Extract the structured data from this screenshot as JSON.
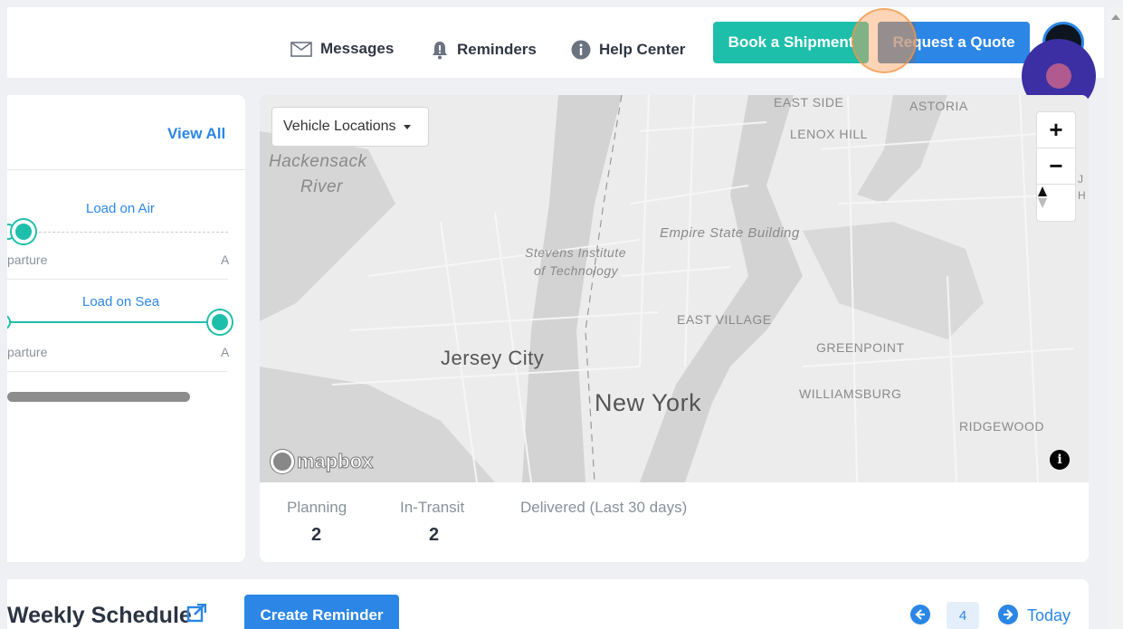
{
  "header": {
    "messages_label": "Messages",
    "reminders_label": "Reminders",
    "help_label": "Help Center",
    "book_label": "Book a Shipment",
    "quote_label": "Request a Quote"
  },
  "shipments_card": {
    "view_all": "View All",
    "rows": [
      {
        "mode": "Load on Air",
        "departure": "parture",
        "arrival": "A"
      },
      {
        "mode": "Load on Sea",
        "departure": "parture",
        "arrival": "A"
      }
    ]
  },
  "map": {
    "dropdown_label": "Vehicle Locations",
    "attribution": "mapbox",
    "labels": {
      "east_side": "EAST SIDE",
      "astoria": "ASTORIA",
      "lenox_hill": "LENOX HILL",
      "hackensack": "Hackensack",
      "river": "River",
      "empire": "Empire State Building",
      "stevens1": "Stevens Institute",
      "stevens2": "of Technology",
      "east_village": "EAST VILLAGE",
      "greenpoint": "GREENPOINT",
      "jersey_city": "Jersey City",
      "new_york": "New York",
      "williamsburg": "WILLIAMSBURG",
      "ridgewood": "RIDGEWOOD",
      "edge_j": "J",
      "edge_h": "H"
    },
    "zoom_in": "+",
    "zoom_out": "−",
    "compass": "▲",
    "info": "i"
  },
  "stats": {
    "planning_label": "Planning",
    "planning_value": "2",
    "transit_label": "In-Transit",
    "transit_value": "2",
    "delivered_label": "Delivered (Last 30 days)"
  },
  "schedule": {
    "title": "Weekly Schedule",
    "create_label": "Create Reminder",
    "page": "4",
    "today_label": "Today"
  },
  "colors": {
    "accent_blue": "#2b86e6",
    "teal": "#1ebfaa",
    "text_dark": "#2b3442"
  }
}
